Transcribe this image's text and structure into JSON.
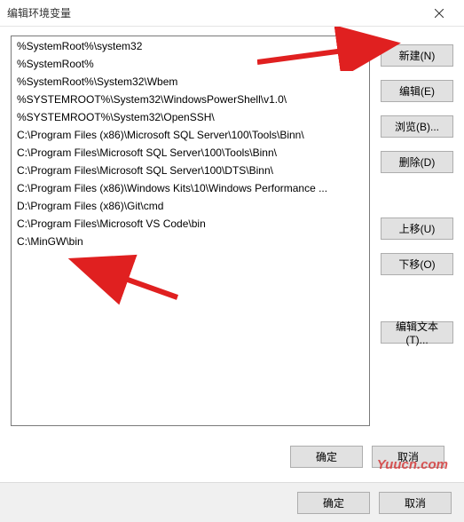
{
  "title": "编辑环境变量",
  "list": {
    "items": [
      "%SystemRoot%\\system32",
      "%SystemRoot%",
      "%SystemRoot%\\System32\\Wbem",
      "%SYSTEMROOT%\\System32\\WindowsPowerShell\\v1.0\\",
      "%SYSTEMROOT%\\System32\\OpenSSH\\",
      "C:\\Program Files (x86)\\Microsoft SQL Server\\100\\Tools\\Binn\\",
      "C:\\Program Files\\Microsoft SQL Server\\100\\Tools\\Binn\\",
      "C:\\Program Files\\Microsoft SQL Server\\100\\DTS\\Binn\\",
      "C:\\Program Files (x86)\\Windows Kits\\10\\Windows Performance ...",
      "D:\\Program Files (x86)\\Git\\cmd",
      "C:\\Program Files\\Microsoft VS Code\\bin",
      "C:\\MinGW\\bin"
    ]
  },
  "buttons": {
    "new_": "新建(N)",
    "edit": "编辑(E)",
    "browse": "浏览(B)...",
    "delete_": "删除(D)",
    "moveUp": "上移(U)",
    "moveDown": "下移(O)",
    "editText": "编辑文本(T)...",
    "ok": "确定",
    "cancel": "取消"
  },
  "watermark": "Yuucn.com"
}
